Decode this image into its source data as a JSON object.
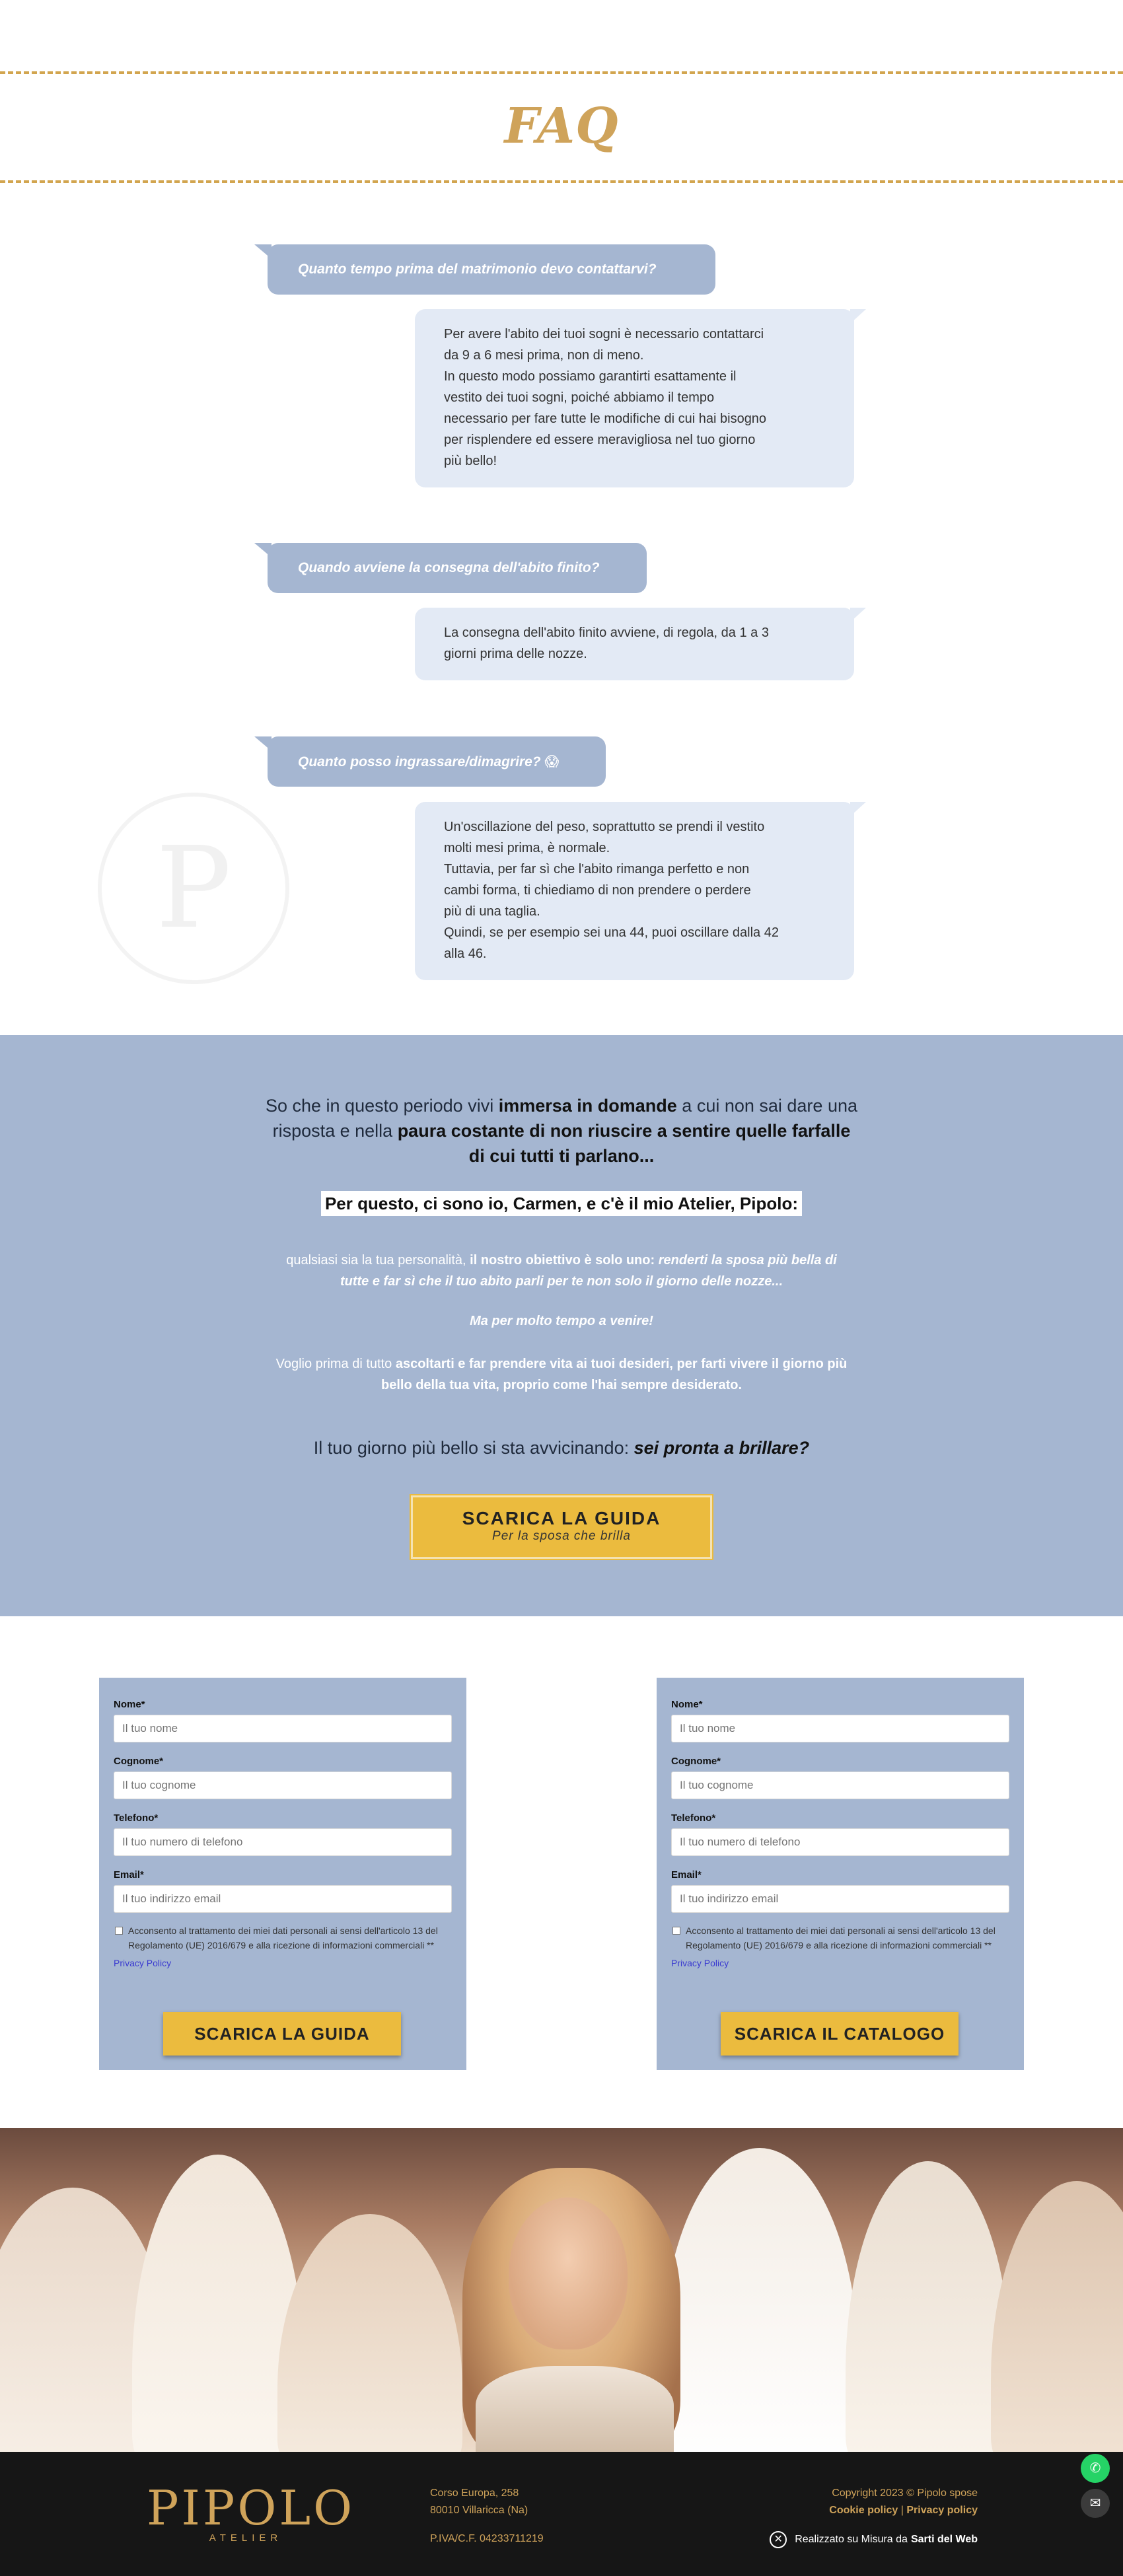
{
  "faq": {
    "title": "FAQ",
    "items": [
      {
        "question": "Quanto tempo prima del matrimonio devo contattarvi?",
        "answer": "Per avere l'abito dei tuoi sogni è necessario contattarci\nda 9 a 6 mesi prima, non di meno.\nIn questo modo possiamo garantirti esattamente il\nvestito dei tuoi sogni, poiché abbiamo il tempo\nnecessario per fare tutte le modifiche di cui hai bisogno\nper risplendere ed essere meravigliosa nel tuo giorno\npiù bello!"
      },
      {
        "question": "Quando avviene la consegna dell'abito finito?",
        "answer": "La consegna dell'abito finito avviene, di regola, da 1 a 3\ngiorni prima delle nozze."
      },
      {
        "question": "Quanto posso ingrassare/dimagrire? 😱",
        "answer": "Un'oscillazione del peso, soprattutto se prendi il vestito\nmolti mesi prima, è normale.\nTuttavia, per far sì che l'abito rimanga perfetto e non\ncambi forma, ti chiediamo di non prendere o perdere\npiù di una taglia.\nQuindi, se per esempio sei una 44, puoi oscillare dalla 42\nalla 46."
      }
    ]
  },
  "watermark_letter": "P",
  "promo": {
    "p1_a": "So che in questo periodo vivi ",
    "p1_b": "immersa in domande",
    "p1_c": " a cui non sai dare una risposta e nella ",
    "p1_d": "paura costante di non riuscire a sentire quelle farfalle di cui tutti ti parlano...",
    "highlight": "Per questo, ci sono io, Carmen, e c'è il mio Atelier, Pipolo:",
    "p3_a": "qualsiasi sia la tua personalità, ",
    "p3_b": "il nostro obiettivo è solo uno: ",
    "p3_c": "renderti la sposa più bella di tutte e far sì che il tuo abito parli per te non solo il giorno delle nozze...",
    "p4": "Ma per molto tempo a venire!",
    "p5_a": "Voglio prima di tutto ",
    "p5_b": "ascoltarti e far prendere vita ai tuoi desideri, per farti vivere il giorno più bello della tua vita, proprio come l'hai sempre desiderato.",
    "p6_a": "Il tuo giorno più bello si sta avvicinando: ",
    "p6_b": "sei pronta a brillare?",
    "button_main": "SCARICA LA GUIDA",
    "button_sub": "Per la sposa che brilla"
  },
  "forms": [
    {
      "nome_label": "Nome*",
      "nome_placeholder": "Il tuo nome",
      "cognome_label": "Cognome*",
      "cognome_placeholder": "Il tuo cognome",
      "telefono_label": "Telefono*",
      "telefono_placeholder": "Il tuo numero di telefono",
      "email_label": "Email*",
      "email_placeholder": "Il tuo indirizzo email",
      "consent": "Acconsento al trattamento dei miei dati personali ai sensi dell'articolo 13 del Regolamento (UE) 2016/679 e alla ricezione di informazioni commerciali **",
      "privacy": "Privacy Policy",
      "submit": "SCARICA LA GUIDA"
    },
    {
      "nome_label": "Nome*",
      "nome_placeholder": "Il tuo nome",
      "cognome_label": "Cognome*",
      "cognome_placeholder": "Il tuo cognome",
      "telefono_label": "Telefono*",
      "telefono_placeholder": "Il tuo numero di telefono",
      "email_label": "Email*",
      "email_placeholder": "Il tuo indirizzo email",
      "consent": "Acconsento al trattamento dei miei dati personali ai sensi dell'articolo 13 del Regolamento (UE) 2016/679 e alla ricezione di informazioni commerciali **",
      "privacy": "Privacy Policy",
      "submit": "SCARICA IL CATALOGO"
    }
  ],
  "footer": {
    "logo_main": "PIPOLO",
    "logo_sub": "ATELIER",
    "address_1": "Corso Europa, 258",
    "address_2": "80010 Villaricca (Na)",
    "piva": "P.IVA/C.F. 04233711219",
    "copyright": "Copyright 2023 © Pipolo spose",
    "cookie": "Cookie policy",
    "separator": "|",
    "privacy": "Privacy policy",
    "credit_a": "Realizzato su Misura da",
    "credit_b": "Sarti del Web"
  },
  "icons": {
    "whatsapp": "whatsapp-icon",
    "mail": "mail-icon",
    "credit": "sarti-del-web-icon"
  },
  "colors": {
    "gold": "#cfa35a",
    "blue": "#a5b6d1",
    "light_blue": "#e3eaf5",
    "yellow": "#ebbb3e",
    "footer_bg": "#161616"
  }
}
